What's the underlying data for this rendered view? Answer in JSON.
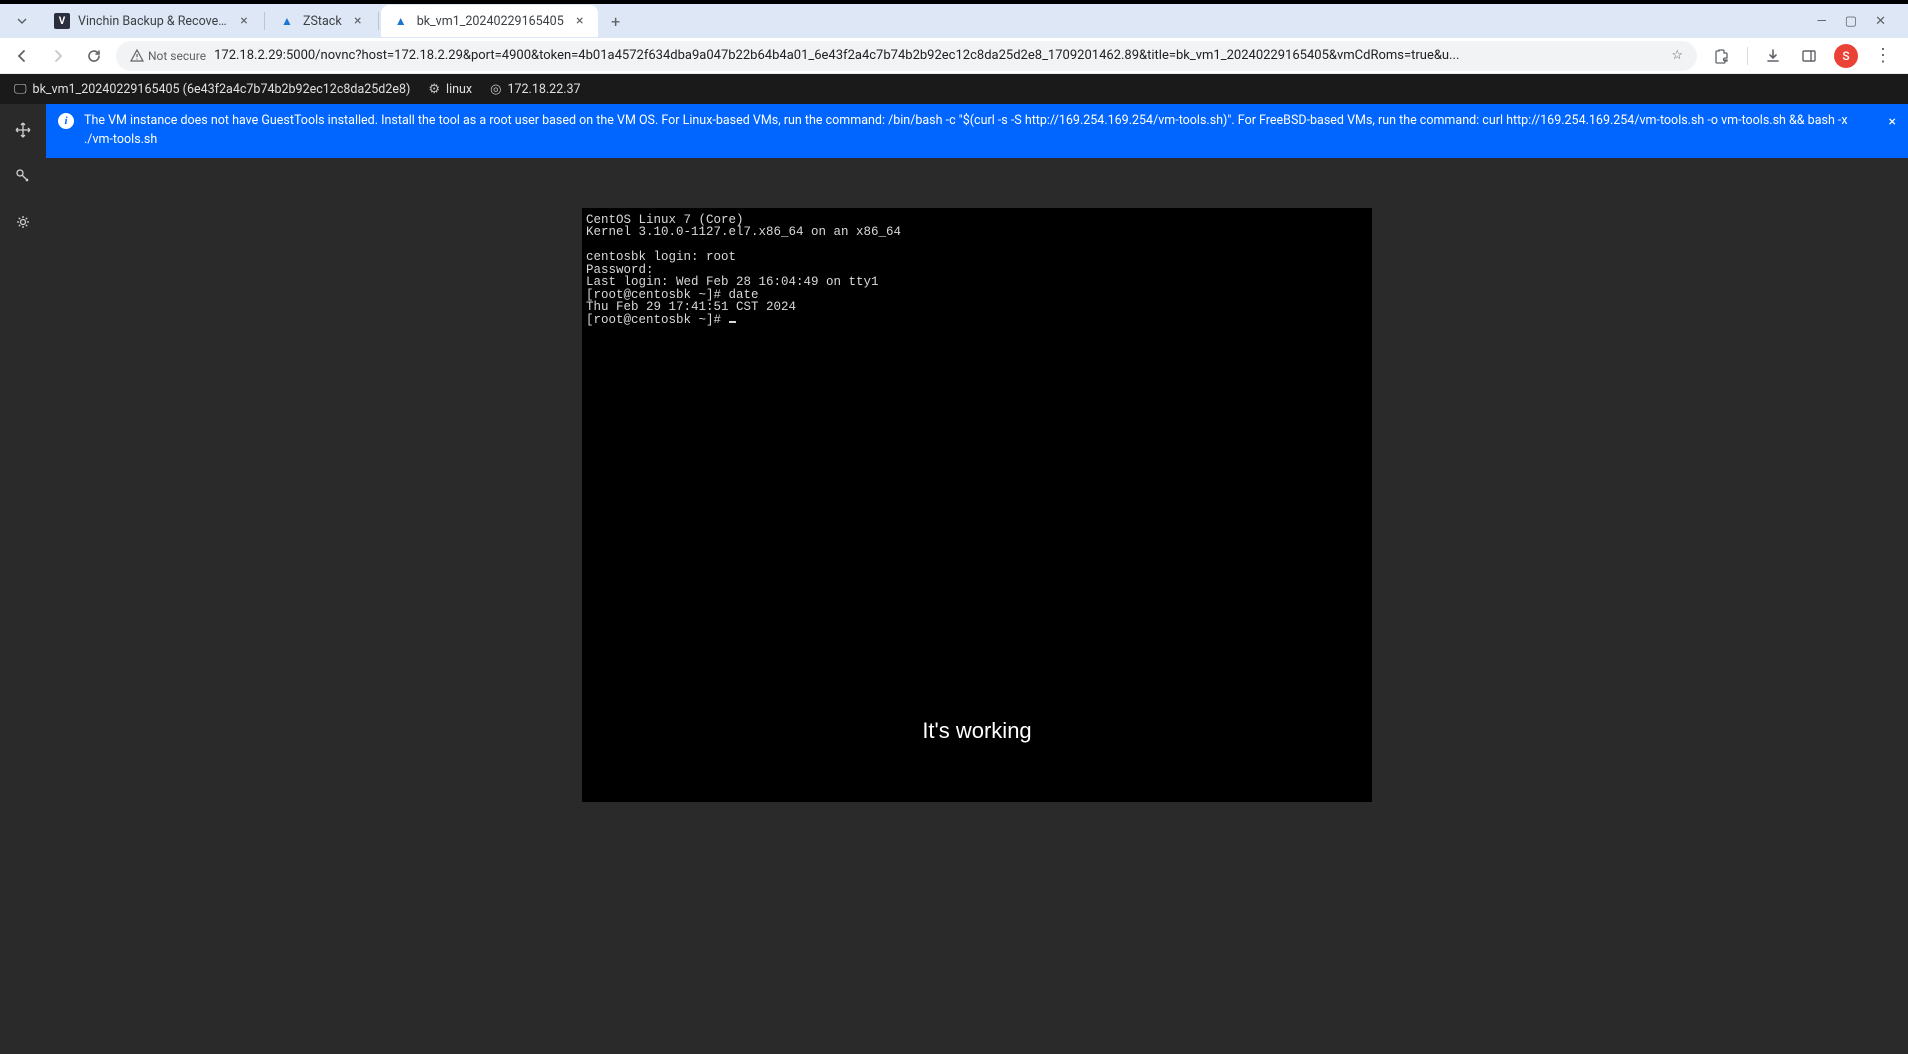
{
  "tabs": [
    {
      "title": "Vinchin Backup & Recovery",
      "favicon_letter": "V",
      "favicon_bg": "#2b2f3d"
    },
    {
      "title": "ZStack",
      "favicon_letter": "▲",
      "favicon_bg": "#fff"
    },
    {
      "title": "bk_vm1_20240229165405",
      "favicon_letter": "▲",
      "favicon_bg": "#fff"
    }
  ],
  "omnibox": {
    "security_label": "Not secure",
    "url": "172.18.2.29:5000/novnc?host=172.18.2.29&port=4900&token=4b01a4572f634dba9a047b22b64b4a01_6e43f2a4c7b74b2b92ec12c8da25d2e8_1709201462.89&title=bk_vm1_20240229165405&vmCdRoms=true&u..."
  },
  "profile_letter": "S",
  "vnc_header": {
    "vm_label": "bk_vm1_20240229165405 (6e43f2a4c7b74b2b92ec12c8da25d2e8)",
    "os_label": "linux",
    "ip_label": "172.18.22.37"
  },
  "banner": {
    "message": "The VM instance does not have GuestTools installed. Install the tool as a root user based on the VM OS. For Linux-based VMs, run the command: /bin/bash -c \"$(curl -s -S http://169.254.169.254/vm-tools.sh)\". For FreeBSD-based VMs, run the command: curl http://169.254.169.254/vm-tools.sh -o vm-tools.sh && bash -x ./vm-tools.sh"
  },
  "terminal": {
    "lines": "CentOS Linux 7 (Core)\nKernel 3.10.0-1127.el7.x86_64 on an x86_64\n\ncentosbk login: root\nPassword:\nLast login: Wed Feb 28 16:04:49 on tty1\n[root@centosbk ~]# date\nThu Feb 29 17:41:51 CST 2024\n[root@centosbk ~]# "
  },
  "caption": "It's working"
}
